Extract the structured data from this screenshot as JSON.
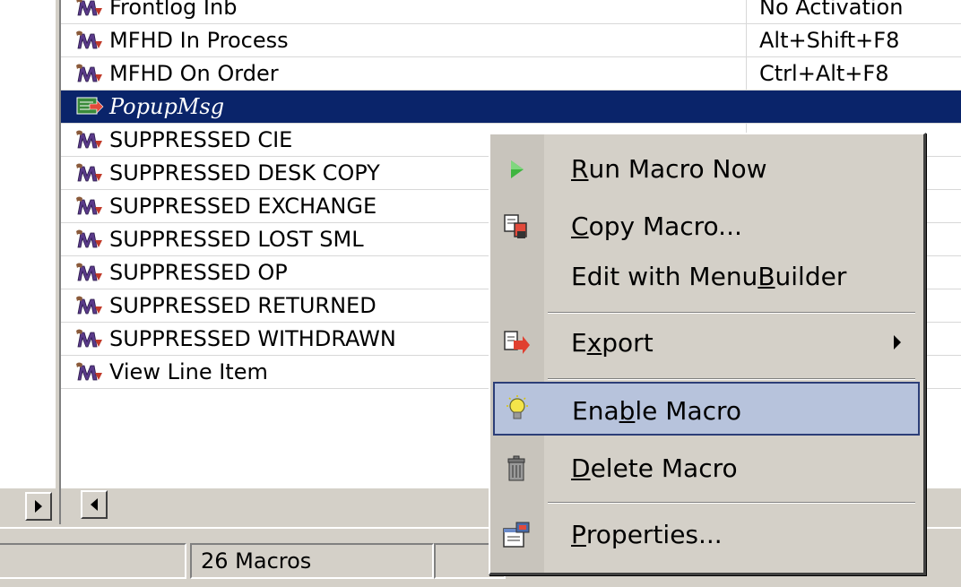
{
  "macro_list": {
    "rows": [
      {
        "name": "Frontlog Inb",
        "key": "No Activation",
        "selected": false
      },
      {
        "name": "MFHD In Process",
        "key": "Alt+Shift+F8",
        "selected": false
      },
      {
        "name": "MFHD On Order",
        "key": "Ctrl+Alt+F8",
        "selected": false
      },
      {
        "name": "PopupMsg",
        "key": "",
        "selected": true
      },
      {
        "name": "SUPPRESSED CIE",
        "key": "",
        "selected": false
      },
      {
        "name": "SUPPRESSED DESK COPY",
        "key": "",
        "selected": false
      },
      {
        "name": "SUPPRESSED EXCHANGE",
        "key": "",
        "selected": false
      },
      {
        "name": "SUPPRESSED LOST SML",
        "key": "",
        "selected": false
      },
      {
        "name": "SUPPRESSED OP",
        "key": "",
        "selected": false
      },
      {
        "name": "SUPPRESSED RETURNED",
        "key": "",
        "selected": false
      },
      {
        "name": "SUPPRESSED WITHDRAWN",
        "key": "",
        "selected": false
      },
      {
        "name": "View Line Item",
        "key": "",
        "selected": false
      }
    ]
  },
  "status_bar": {
    "count_label": "26 Macros"
  },
  "context_menu": {
    "items": [
      {
        "label_pre": "",
        "label_u": "R",
        "label_post": "un Macro Now",
        "icon": "play-icon"
      },
      {
        "label_pre": "",
        "label_u": "C",
        "label_post": "opy Macro...",
        "icon": "copy-macro-icon"
      },
      {
        "label_pre": "Edit with Menu ",
        "label_u": "B",
        "label_post": "uilder",
        "icon": ""
      },
      {
        "label_pre": "E",
        "label_u": "x",
        "label_post": "port",
        "icon": "export-icon"
      },
      {
        "label_pre": "Ena",
        "label_u": "b",
        "label_post": "le Macro",
        "icon": "lightbulb-icon"
      },
      {
        "label_pre": "",
        "label_u": "D",
        "label_post": "elete Macro",
        "icon": "trash-icon"
      },
      {
        "label_pre": "",
        "label_u": "P",
        "label_post": "roperties...",
        "icon": "properties-icon"
      }
    ]
  },
  "colors": {
    "selection": "#0a246a",
    "menu_highlight": "#b7c3dc",
    "chrome": "#d4d0c8"
  }
}
